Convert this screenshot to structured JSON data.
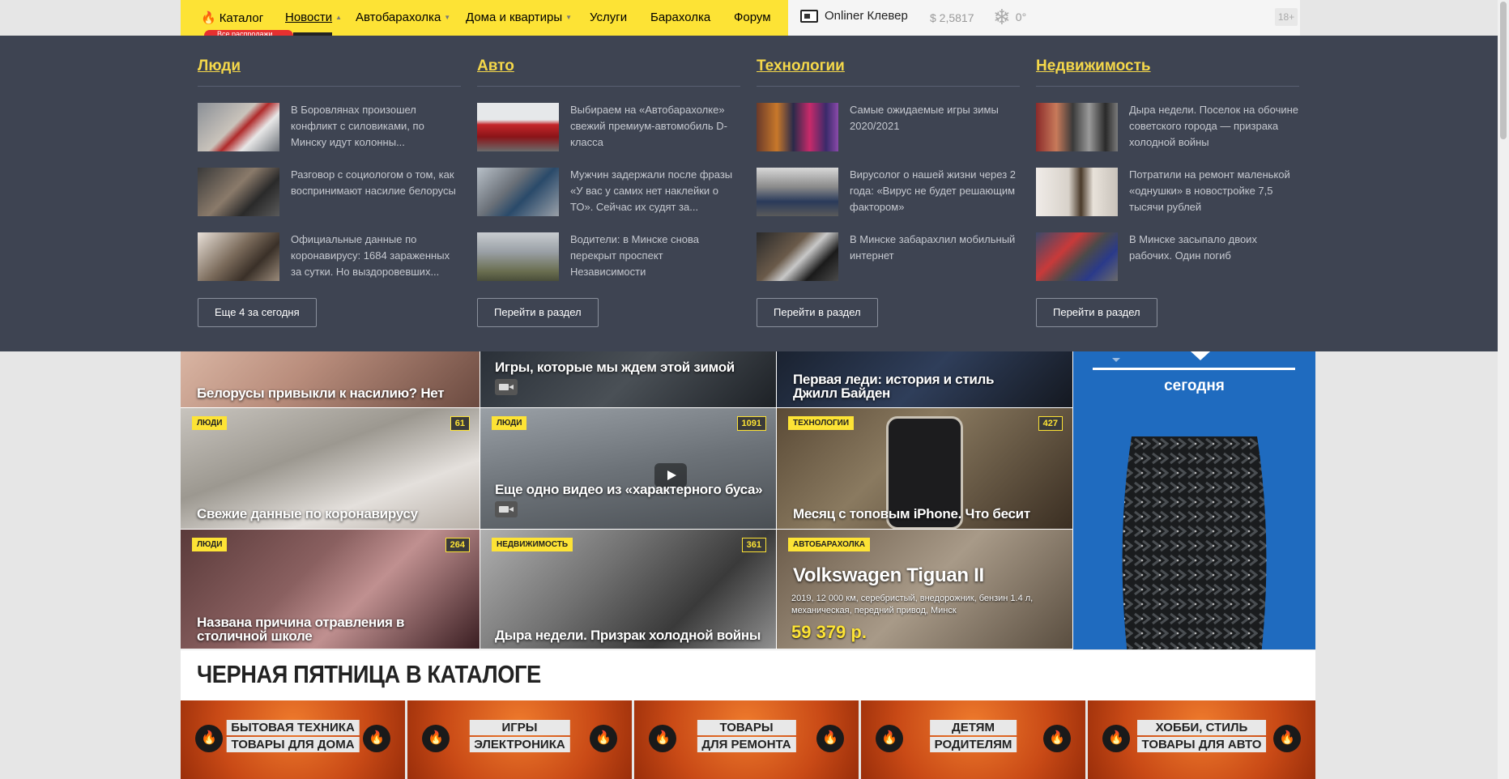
{
  "nav": {
    "items": [
      {
        "label": "Каталог"
      },
      {
        "label": "Новости"
      },
      {
        "label": "Автобарахолка"
      },
      {
        "label": "Дома и квартиры"
      },
      {
        "label": "Услуги"
      },
      {
        "label": "Барахолка"
      },
      {
        "label": "Форум"
      }
    ],
    "active": "Новости",
    "promo": "Все распродажи",
    "clever": "Onliner Клевер",
    "rate": "$ 2,5817",
    "weather": "0°",
    "age": "18+"
  },
  "dropdown": {
    "columns": [
      {
        "title": "Люди",
        "news": [
          "В Боровлянах произошел конфликт с силовиками, по Минску идут колонны...",
          "Разговор с социологом о том, как воспринимают насилие белорусы",
          "Официальные данные по коронавирусу: 1684 зараженных за сутки. Но выздоровевших..."
        ],
        "button": "Еще 4 за сегодня"
      },
      {
        "title": "Авто",
        "news": [
          "Выбираем на «Автобарахолке» свежий премиум-автомобиль D-класса",
          "Мужчин задержали после фразы «У вас у самих нет наклейки о ТО». Сейчас их судят за...",
          "Водители: в Минске снова перекрыт проспект Независимости"
        ],
        "button": "Перейти в раздел"
      },
      {
        "title": "Технологии",
        "news": [
          "Самые ожидаемые игры зимы 2020/2021",
          "Вирусолог о нашей жизни через 2 года: «Вирус не будет решающим фактором»",
          "В Минске забарахлил мобильный интернет"
        ],
        "button": "Перейти в раздел"
      },
      {
        "title": "Недвижимость",
        "news": [
          "Дыра недели. Поселок на обочине советского города — призрака холодной войны",
          "Потратили на ремонт маленькой «однушки» в новостройке 7,5 тысячи рублей",
          "В Минске засыпало двоих рабочих. Один погиб"
        ],
        "button": "Перейти в раздел"
      }
    ]
  },
  "tiles": [
    {
      "title": "Белорусы привыкли к насилию? Нет",
      "tag": "",
      "count": ""
    },
    {
      "title": "Игры, которые мы ждем этой зимой",
      "tag": "",
      "count": ""
    },
    {
      "title": "Первая леди: история и стиль Джилл Байден",
      "tag": "",
      "count": ""
    },
    {
      "title": "Свежие данные по коронавирусу",
      "tag": "ЛЮДИ",
      "count": "61"
    },
    {
      "title": "Еще одно видео из «характерного буса»",
      "tag": "ЛЮДИ",
      "count": "1091"
    },
    {
      "title": "Месяц с топовым iPhone. Что бесит",
      "tag": "ТЕХНОЛОГИИ",
      "count": "427"
    },
    {
      "title": "Названа причина отравления в столичной школе",
      "tag": "ЛЮДИ",
      "count": "264"
    },
    {
      "title": "Дыра недели. Призрак холодной войны",
      "tag": "НЕДВИЖИМОСТЬ",
      "count": "361"
    },
    {
      "title": "Volkswagen Tiguan II",
      "tag": "АВТОБАРАХОЛКА",
      "count": "",
      "details": "2019, 12 000 км, серебристый, внедорожник, бензин 1.4 л, механическая, передний привод, Минск",
      "price": "59 379 р."
    }
  ],
  "ad": {
    "text": "сегодня"
  },
  "black_friday": {
    "title": "ЧЕРНАЯ ПЯТНИЦА В КАТАЛОГЕ",
    "cards": [
      [
        "БЫТОВАЯ ТЕХНИКА",
        "ТОВАРЫ ДЛЯ ДОМА"
      ],
      [
        "ИГРЫ",
        "ЭЛЕКТРОНИКА"
      ],
      [
        "ТОВАРЫ",
        "ДЛЯ РЕМОНТА"
      ],
      [
        "ДЕТЯМ",
        "РОДИТЕЛЯМ"
      ],
      [
        "ХОББИ, СТИЛЬ",
        "ТОВАРЫ ДЛЯ АВТО"
      ]
    ]
  },
  "colors": {
    "brand_yellow": "#fde335",
    "dropdown_bg": "#3e4452",
    "title_yellow": "#f5d84a",
    "ad_blue": "#1f6bbf"
  }
}
